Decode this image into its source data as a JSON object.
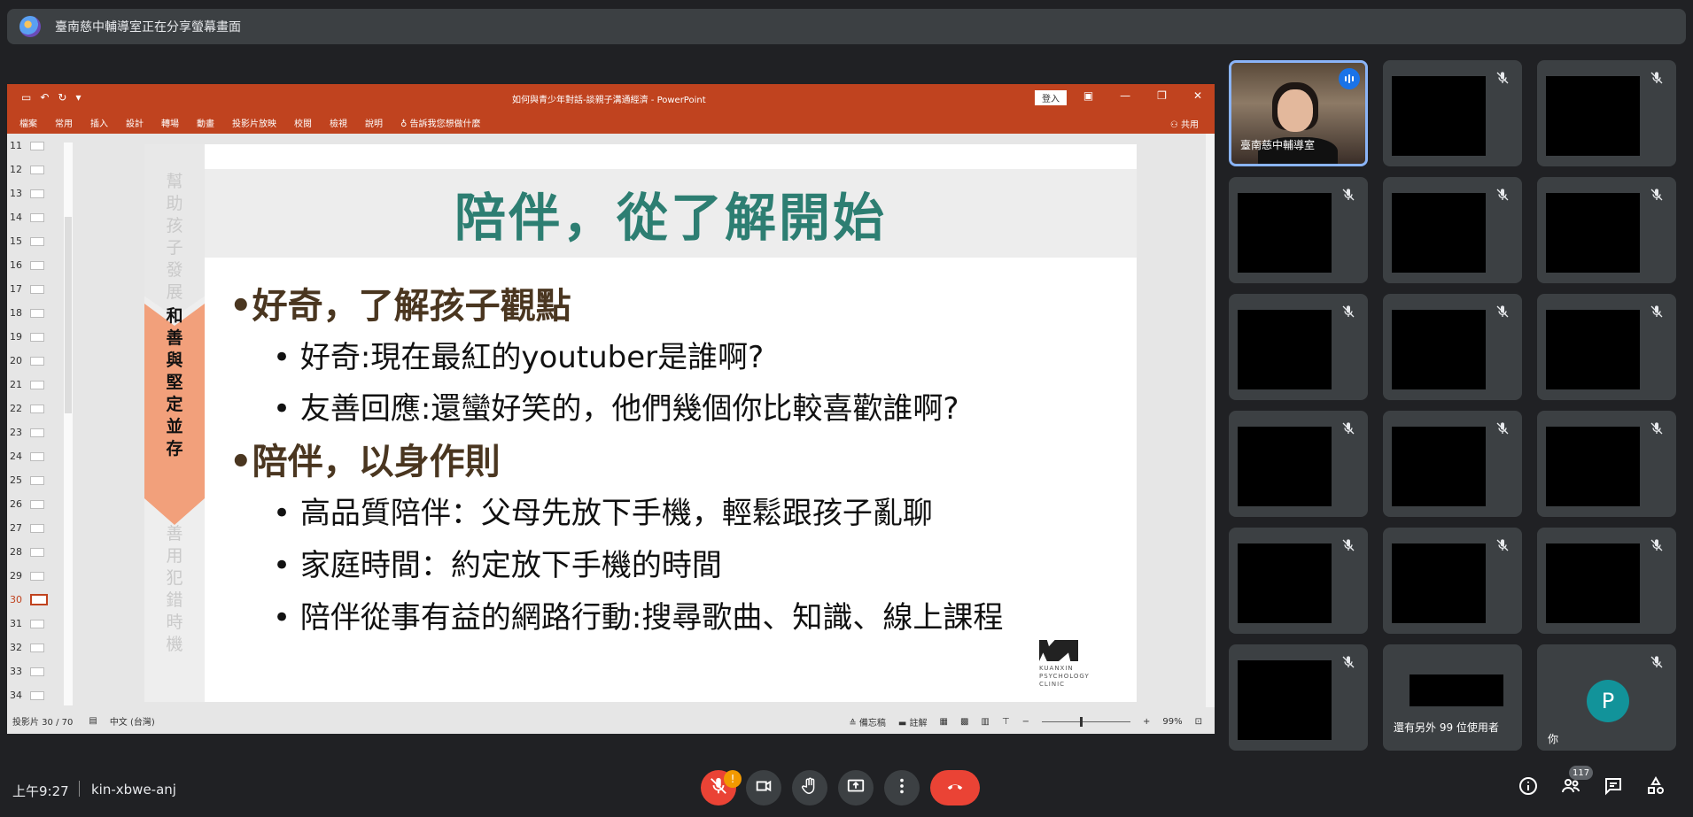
{
  "banner": {
    "text": "臺南慈中輔導室正在分享螢幕畫面",
    "avatar_icon": "presenter-avatar"
  },
  "ppt": {
    "doc_title": "如何與青少年對話-談親子溝通經濟 - PowerPoint",
    "signin": "登入",
    "ribbon_tabs": [
      "檔案",
      "常用",
      "插入",
      "設計",
      "轉場",
      "動畫",
      "投影片放映",
      "校閱",
      "檢視",
      "說明"
    ],
    "tellme": "告訴我您想做什麼",
    "share": "共用",
    "thumb_numbers": [
      "11",
      "12",
      "13",
      "14",
      "15",
      "16",
      "17",
      "18",
      "19",
      "20",
      "21",
      "22",
      "23",
      "24",
      "25",
      "26",
      "27",
      "28",
      "29",
      "30",
      "31",
      "32",
      "33",
      "34"
    ],
    "active_slide": "30",
    "status": {
      "slide_of": "投影片 30 / 70",
      "lang": "中文 (台灣)",
      "notes": "備忘稿",
      "comments": "註解",
      "zoom": "99%"
    }
  },
  "slide": {
    "left_top": [
      "幫",
      "助",
      "孩",
      "子",
      "發",
      "展"
    ],
    "left_mid": [
      "和",
      "善",
      "與",
      "堅",
      "定",
      "並",
      "存"
    ],
    "left_bot": [
      "善",
      "用",
      "犯",
      "錯",
      "時",
      "機"
    ],
    "headline": "陪伴，從了解開始",
    "bullets": [
      {
        "level": 1,
        "text": "•好奇，了解孩子觀點"
      },
      {
        "level": 2,
        "text": "• 好奇:現在最紅的youtuber是誰啊?"
      },
      {
        "level": 2,
        "text": "• 友善回應:還蠻好笑的，他們幾個你比較喜歡誰啊?"
      },
      {
        "level": 1,
        "text": "•陪伴，以身作則"
      },
      {
        "level": 2,
        "text": "• 高品質陪伴：父母先放下手機，輕鬆跟孩子亂聊"
      },
      {
        "level": 2,
        "text": "• 家庭時間：約定放下手機的時間"
      },
      {
        "level": 2,
        "text": "• 陪伴從事有益的網路行動:搜尋歌曲、知識、線上課程"
      }
    ],
    "logo_lines": [
      "KUANXIN",
      "PSYCHOLOGY",
      "CLINIC"
    ]
  },
  "tiles": {
    "speaker_name": "臺南慈中輔導室",
    "others_label": "還有另外 99 位使用者",
    "self_label": "你",
    "self_initial": "P"
  },
  "bottom": {
    "time": "上午9:27",
    "meeting_code": "kin-xbwe-anj",
    "mic_badge": "!",
    "participants_count": "117"
  },
  "colors": {
    "ppt_accent": "#c0431f",
    "headline": "#2d7e72",
    "leave": "#ea4335",
    "speaking": "#8ab4f8",
    "self_avatar": "#12939a"
  }
}
